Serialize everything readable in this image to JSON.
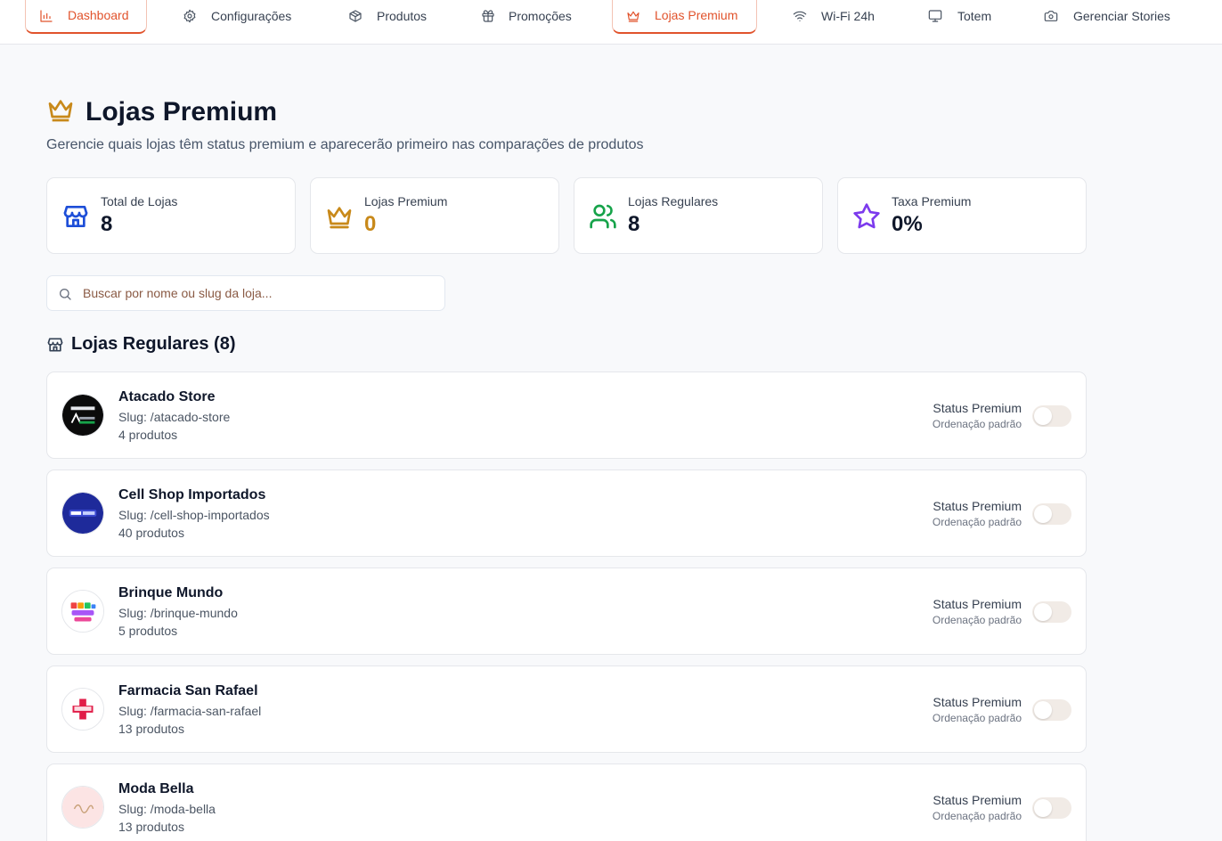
{
  "nav": {
    "items": [
      {
        "label": "Dashboard",
        "icon": "bar-chart-icon",
        "active": true
      },
      {
        "label": "Configurações",
        "icon": "gear-icon",
        "active": false
      },
      {
        "label": "Produtos",
        "icon": "package-icon",
        "active": false
      },
      {
        "label": "Promoções",
        "icon": "gift-icon",
        "active": false
      },
      {
        "label": "Lojas Premium",
        "icon": "crown-icon",
        "active": true
      },
      {
        "label": "Wi-Fi 24h",
        "icon": "wifi-icon",
        "active": false
      },
      {
        "label": "Totem",
        "icon": "monitor-icon",
        "active": false
      },
      {
        "label": "Gerenciar Stories",
        "icon": "camera-icon",
        "active": false
      }
    ]
  },
  "header": {
    "title": "Lojas Premium",
    "subtitle": "Gerencie quais lojas têm status premium e aparecerão primeiro nas comparações de produtos",
    "icon": "crown-icon"
  },
  "stats": [
    {
      "label": "Total de Lojas",
      "value": "8",
      "icon": "store-icon",
      "color": "#1d4ed8"
    },
    {
      "label": "Lojas Premium",
      "value": "0",
      "icon": "crown-icon",
      "color": "#c8891a"
    },
    {
      "label": "Lojas Regulares",
      "value": "8",
      "icon": "users-icon",
      "color": "#16a34a"
    },
    {
      "label": "Taxa Premium",
      "value": "0%",
      "icon": "star-icon",
      "color": "#7c3aed"
    }
  ],
  "search": {
    "placeholder": "Buscar por nome ou slug da loja...",
    "value": ""
  },
  "section": {
    "title": "Lojas Regulares (8)",
    "icon": "store-icon"
  },
  "stores": [
    {
      "name": "Atacado Store",
      "slug": "Slug: /atacado-store",
      "count": "4 produtos",
      "status_label": "Status Premium",
      "status_sub": "Ordenação padrão",
      "premium": false
    },
    {
      "name": "Cell Shop Importados",
      "slug": "Slug: /cell-shop-importados",
      "count": "40 produtos",
      "status_label": "Status Premium",
      "status_sub": "Ordenação padrão",
      "premium": false
    },
    {
      "name": "Brinque Mundo",
      "slug": "Slug: /brinque-mundo",
      "count": "5 produtos",
      "status_label": "Status Premium",
      "status_sub": "Ordenação padrão",
      "premium": false
    },
    {
      "name": "Farmacia San Rafael",
      "slug": "Slug: /farmacia-san-rafael",
      "count": "13 produtos",
      "status_label": "Status Premium",
      "status_sub": "Ordenação padrão",
      "premium": false
    },
    {
      "name": "Moda Bella",
      "slug": "Slug: /moda-bella",
      "count": "13 produtos",
      "status_label": "Status Premium",
      "status_sub": "Ordenação padrão",
      "premium": false
    }
  ],
  "colors": {
    "accent": "#e1532c",
    "premium": "#c8891a"
  }
}
